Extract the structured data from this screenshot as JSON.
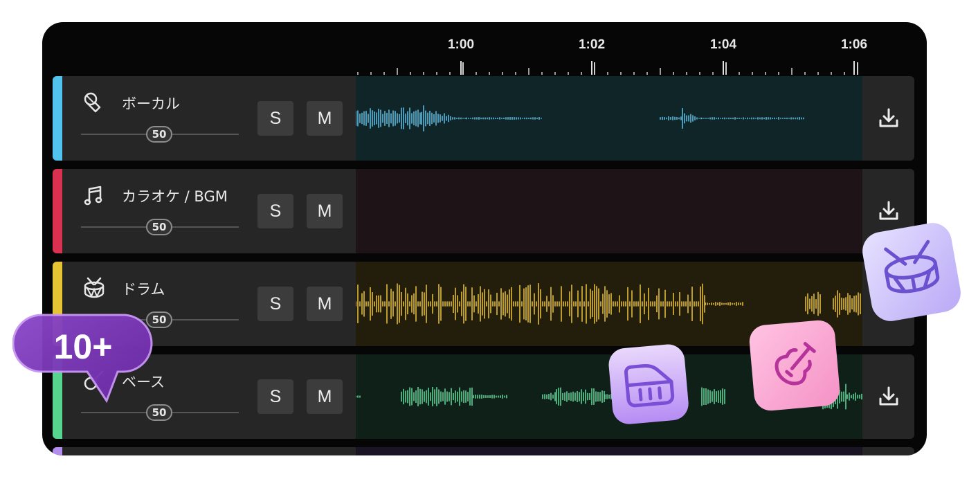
{
  "timeline": {
    "times": [
      "1:00",
      "1:02",
      "1:04",
      "1:06"
    ]
  },
  "tracks": [
    {
      "name": "ボーカル",
      "icon": "microphone-icon",
      "volume": "50",
      "solo_label": "S",
      "mute_label": "M",
      "color": "#52c3ef",
      "region_color": "#0f2528",
      "wave_color": "#5ab8dc"
    },
    {
      "name": "カラオケ / BGM",
      "icon": "music-note-icon",
      "volume": "50",
      "solo_label": "S",
      "mute_label": "M",
      "color": "#d9314f",
      "region_color": "#1e1316",
      "wave_color": "#d9314f"
    },
    {
      "name": "ドラム",
      "icon": "drum-icon",
      "volume": "50",
      "solo_label": "S",
      "mute_label": "M",
      "color": "#e6c535",
      "region_color": "#231e0c",
      "wave_color": "#e0bb35"
    },
    {
      "name": "ベース",
      "icon": "bass-icon",
      "volume": "50",
      "solo_label": "S",
      "mute_label": "M",
      "color": "#55d58e",
      "region_color": "#0f2019",
      "wave_color": "#5ccf95"
    }
  ],
  "badge": {
    "text": "10+"
  },
  "floating_icons": [
    "piano-icon",
    "guitar-icon",
    "drum-icon"
  ]
}
